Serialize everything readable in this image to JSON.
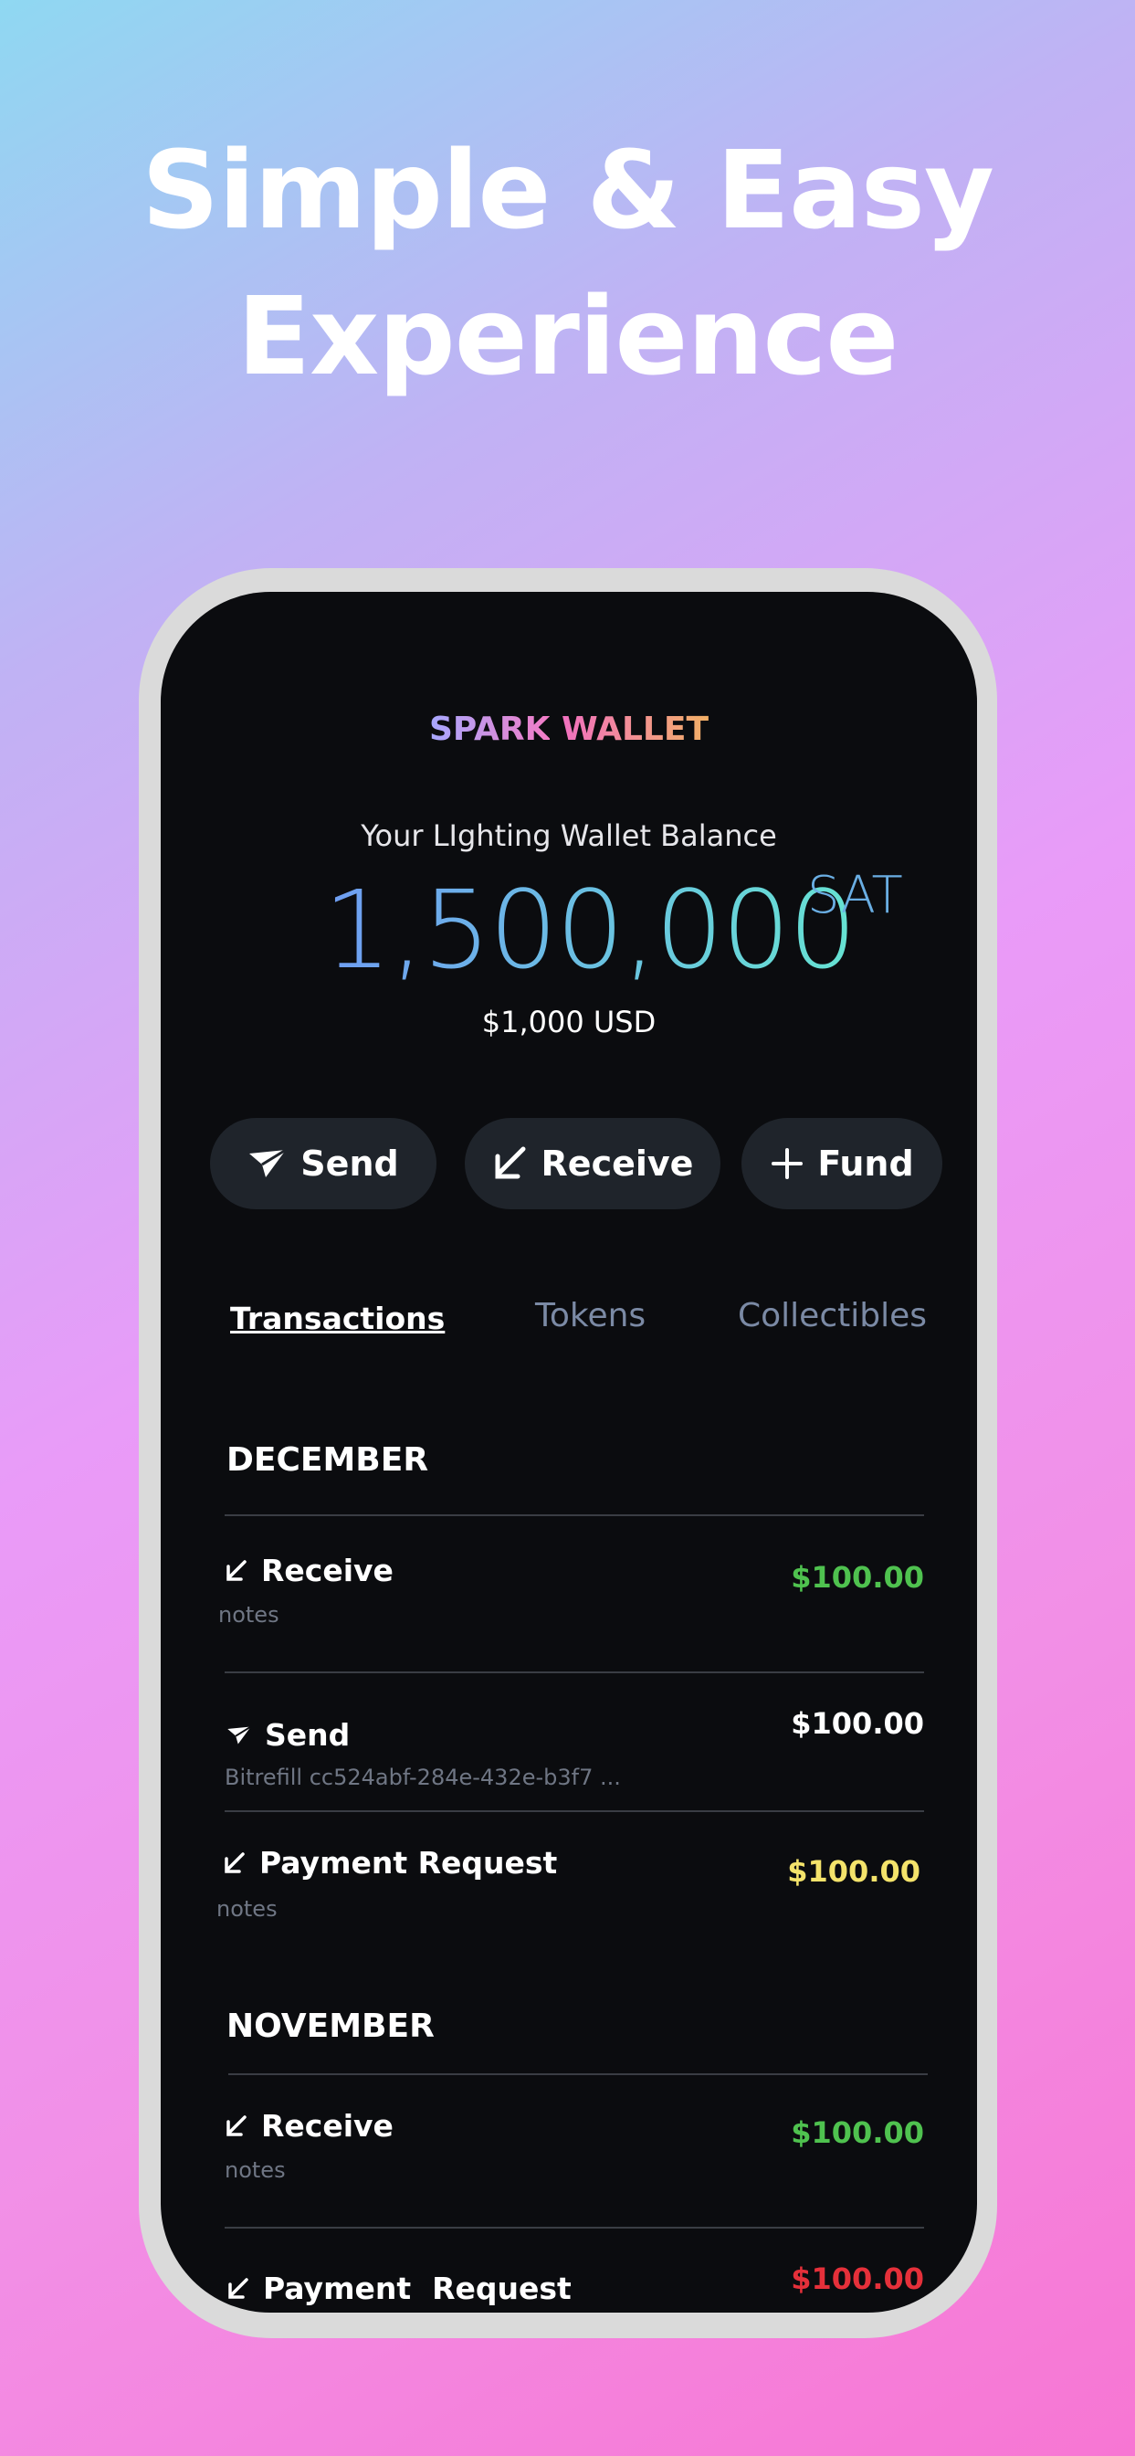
{
  "headline": {
    "line1": "Simple & Easy",
    "line2": "Experience"
  },
  "app": {
    "brand_part1": "SPARK",
    "brand_part2": "WALLET",
    "balance_label": "Your LIghting Wallet Balance",
    "balance_amount": "1,500,000",
    "balance_unit": "SAT",
    "balance_usd": "$1,000 USD"
  },
  "actions": [
    {
      "label": "Send",
      "icon": "send-icon"
    },
    {
      "label": "Receive",
      "icon": "arrow-down-left-icon"
    },
    {
      "label": "Fund",
      "icon": "plus-icon"
    }
  ],
  "tabs": [
    {
      "label": "Transactions",
      "active": true
    },
    {
      "label": "Tokens",
      "active": false
    },
    {
      "label": "Collectibles",
      "active": false
    }
  ],
  "months": [
    {
      "name": "DECEMBER",
      "transactions": [
        {
          "title": "Receive",
          "note": "notes",
          "amount": "$100.00",
          "color": "#4fc24f",
          "icon": "arrow-down-left-icon"
        },
        {
          "title": "Send",
          "note": "Bitrefill  cc524abf-284e-432e-b3f7 ...",
          "amount": "$100.00",
          "color": "#ffffff",
          "icon": "send-icon"
        },
        {
          "title": "Payment Request",
          "note": "notes",
          "amount": "$100.00",
          "color": "#f4e36b",
          "icon": "arrow-down-left-icon"
        }
      ]
    },
    {
      "name": "NOVEMBER",
      "transactions": [
        {
          "title": "Receive",
          "note": "notes",
          "amount": "$100.00",
          "color": "#4fc24f",
          "icon": "arrow-down-left-icon"
        },
        {
          "title": "Payment  Request",
          "note": "",
          "amount": "$100.00",
          "color": "#e5303a",
          "icon": "arrow-down-left-icon"
        }
      ]
    }
  ],
  "colors": {
    "income": "#4fc24f",
    "pending": "#f4e36b",
    "expense": "#e5303a",
    "screen_bg": "#0b0c0f",
    "button_bg": "#1f242b"
  }
}
